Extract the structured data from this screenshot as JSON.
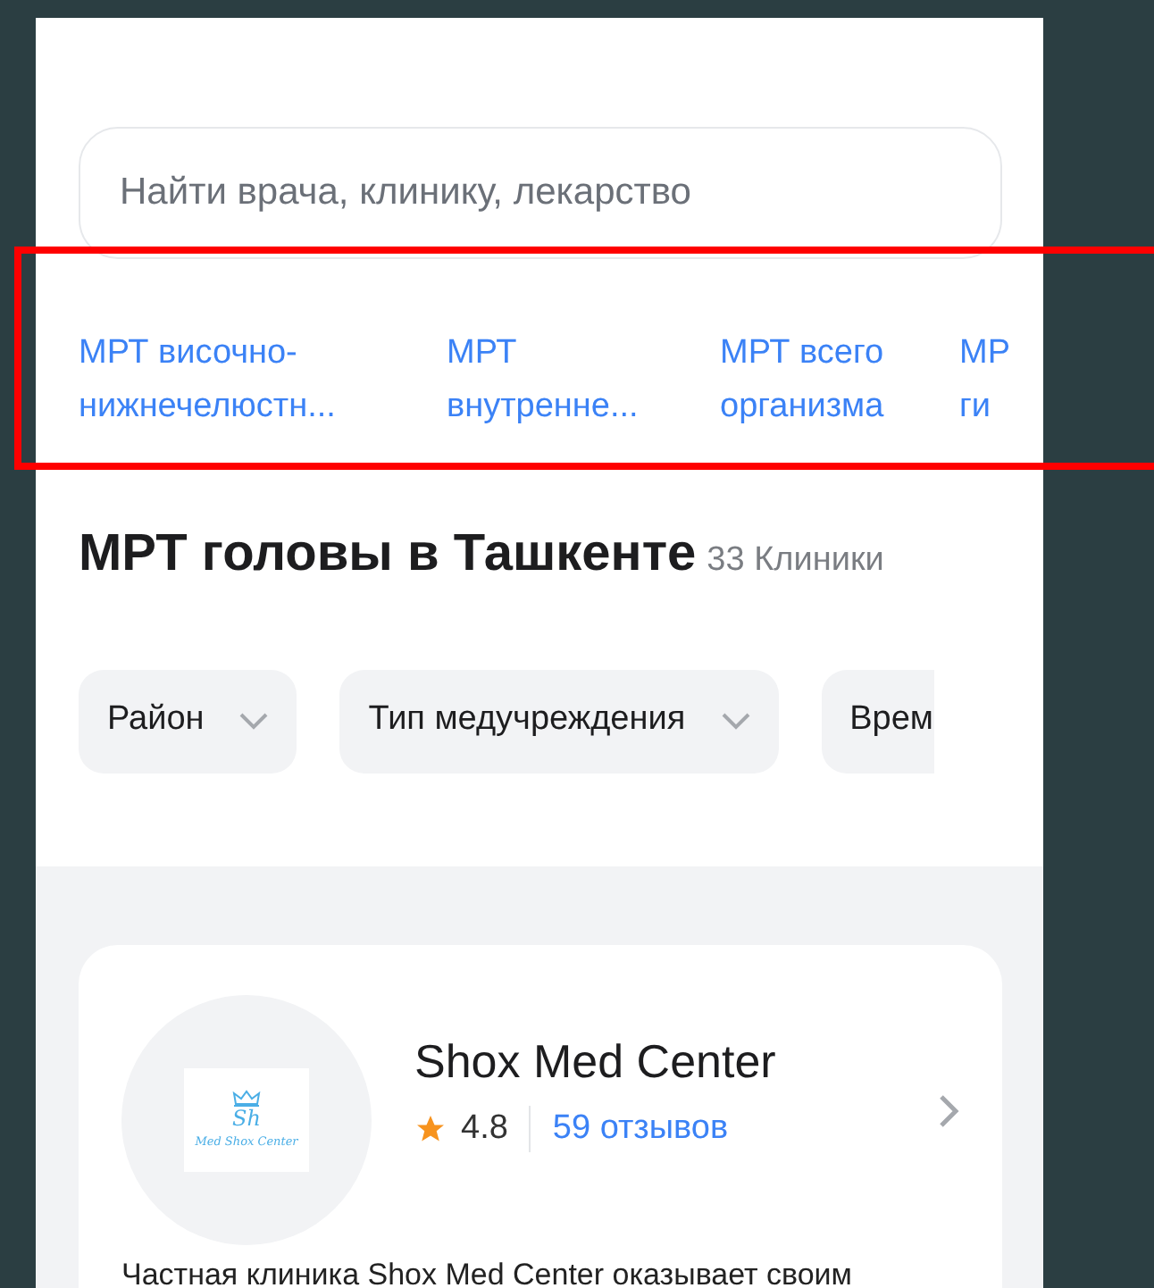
{
  "search": {
    "placeholder": "Найти врача, клинику, лекарство"
  },
  "related_links": [
    {
      "lines": [
        "МРТ височно-",
        "нижнечелюстн..."
      ]
    },
    {
      "lines": [
        "МРТ",
        "внутренне..."
      ]
    },
    {
      "lines": [
        "МРТ всего",
        "организма"
      ]
    },
    {
      "lines": [
        "МР",
        "ги"
      ]
    }
  ],
  "heading": {
    "title": "МРТ головы в Ташкенте",
    "count": "33 Клиники"
  },
  "filters": [
    {
      "label": "Район",
      "dropdown": true
    },
    {
      "label": "Тип медучреждения",
      "dropdown": true
    },
    {
      "label": "Врем",
      "dropdown": false
    }
  ],
  "clinics": [
    {
      "logo_monogram": "Sh",
      "logo_caption": "Med Shox Center",
      "name": "Shox Med Center",
      "rating": "4.8",
      "reviews": "59 отзывов",
      "description": "Частная клиника Shox Med Center оказывает своим"
    }
  ]
}
